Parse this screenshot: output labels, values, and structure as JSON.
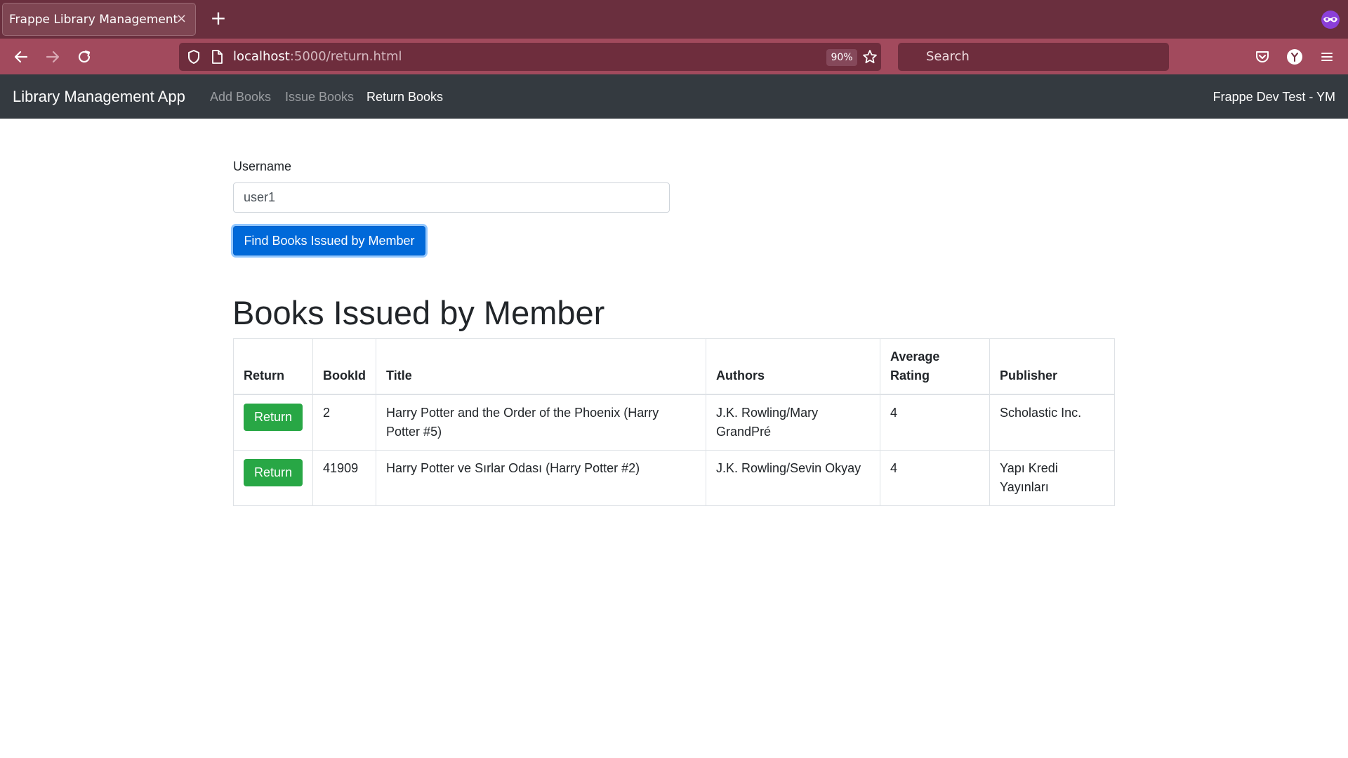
{
  "browser": {
    "tab_title": "Frappe Library Management",
    "tab_close": "×",
    "new_tab": "+",
    "url_host": "localhost",
    "url_rest": ":5000/return.html",
    "zoom": "90%",
    "search_placeholder": "Search"
  },
  "nav": {
    "brand": "Library Management App",
    "links": [
      "Add Books",
      "Issue Books",
      "Return Books"
    ],
    "active": "Return Books",
    "right_text": "Frappe Dev Test - YM"
  },
  "form": {
    "username_label": "Username",
    "username_value": "user1",
    "find_button": "Find Books Issued by Member"
  },
  "results": {
    "heading": "Books Issued by Member",
    "columns": [
      "Return",
      "BookId",
      "Title",
      "Authors",
      "Average Rating",
      "Publisher"
    ],
    "rows": [
      {
        "return_label": "Return",
        "book_id": "2",
        "title": "Harry Potter and the Order of the Phoenix (Harry Potter #5)",
        "authors": "J.K. Rowling/Mary GrandPré",
        "average_rating": "4",
        "publisher": "Scholastic Inc."
      },
      {
        "return_label": "Return",
        "book_id": "41909",
        "title": "Harry Potter ve Sırlar Odası (Harry Potter #2)",
        "authors": "J.K. Rowling/Sevin Okyay",
        "average_rating": "4",
        "publisher": "Yapı Kredi Yayınları"
      }
    ]
  },
  "colors": {
    "tabbar": "#6a2f3e",
    "toolbar": "#a24a5d",
    "app_navbar": "#343a40",
    "primary": "#0069d9",
    "success": "#28a745"
  }
}
